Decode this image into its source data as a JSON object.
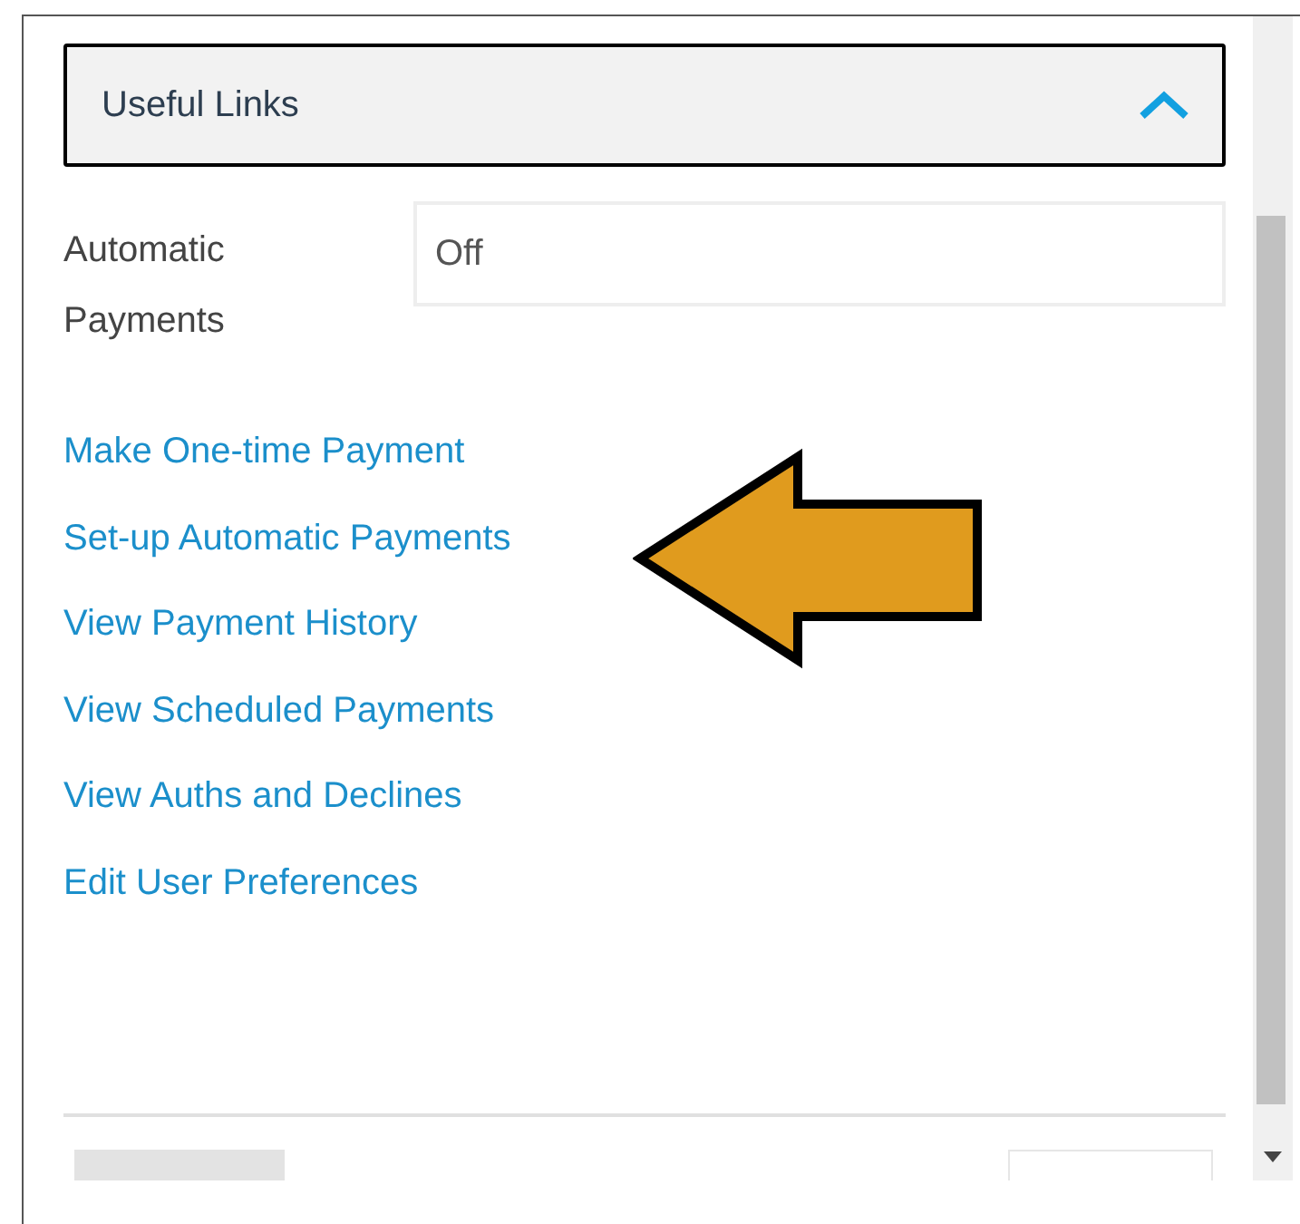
{
  "section": {
    "title": "Useful Links",
    "expanded": true
  },
  "field": {
    "label": "Automatic Payments",
    "value": "Off"
  },
  "links": [
    "Make One-time Payment",
    "Set-up Automatic Payments",
    "View Payment History",
    "View Scheduled Payments",
    "View Auths and Declines",
    "Edit User Preferences"
  ]
}
